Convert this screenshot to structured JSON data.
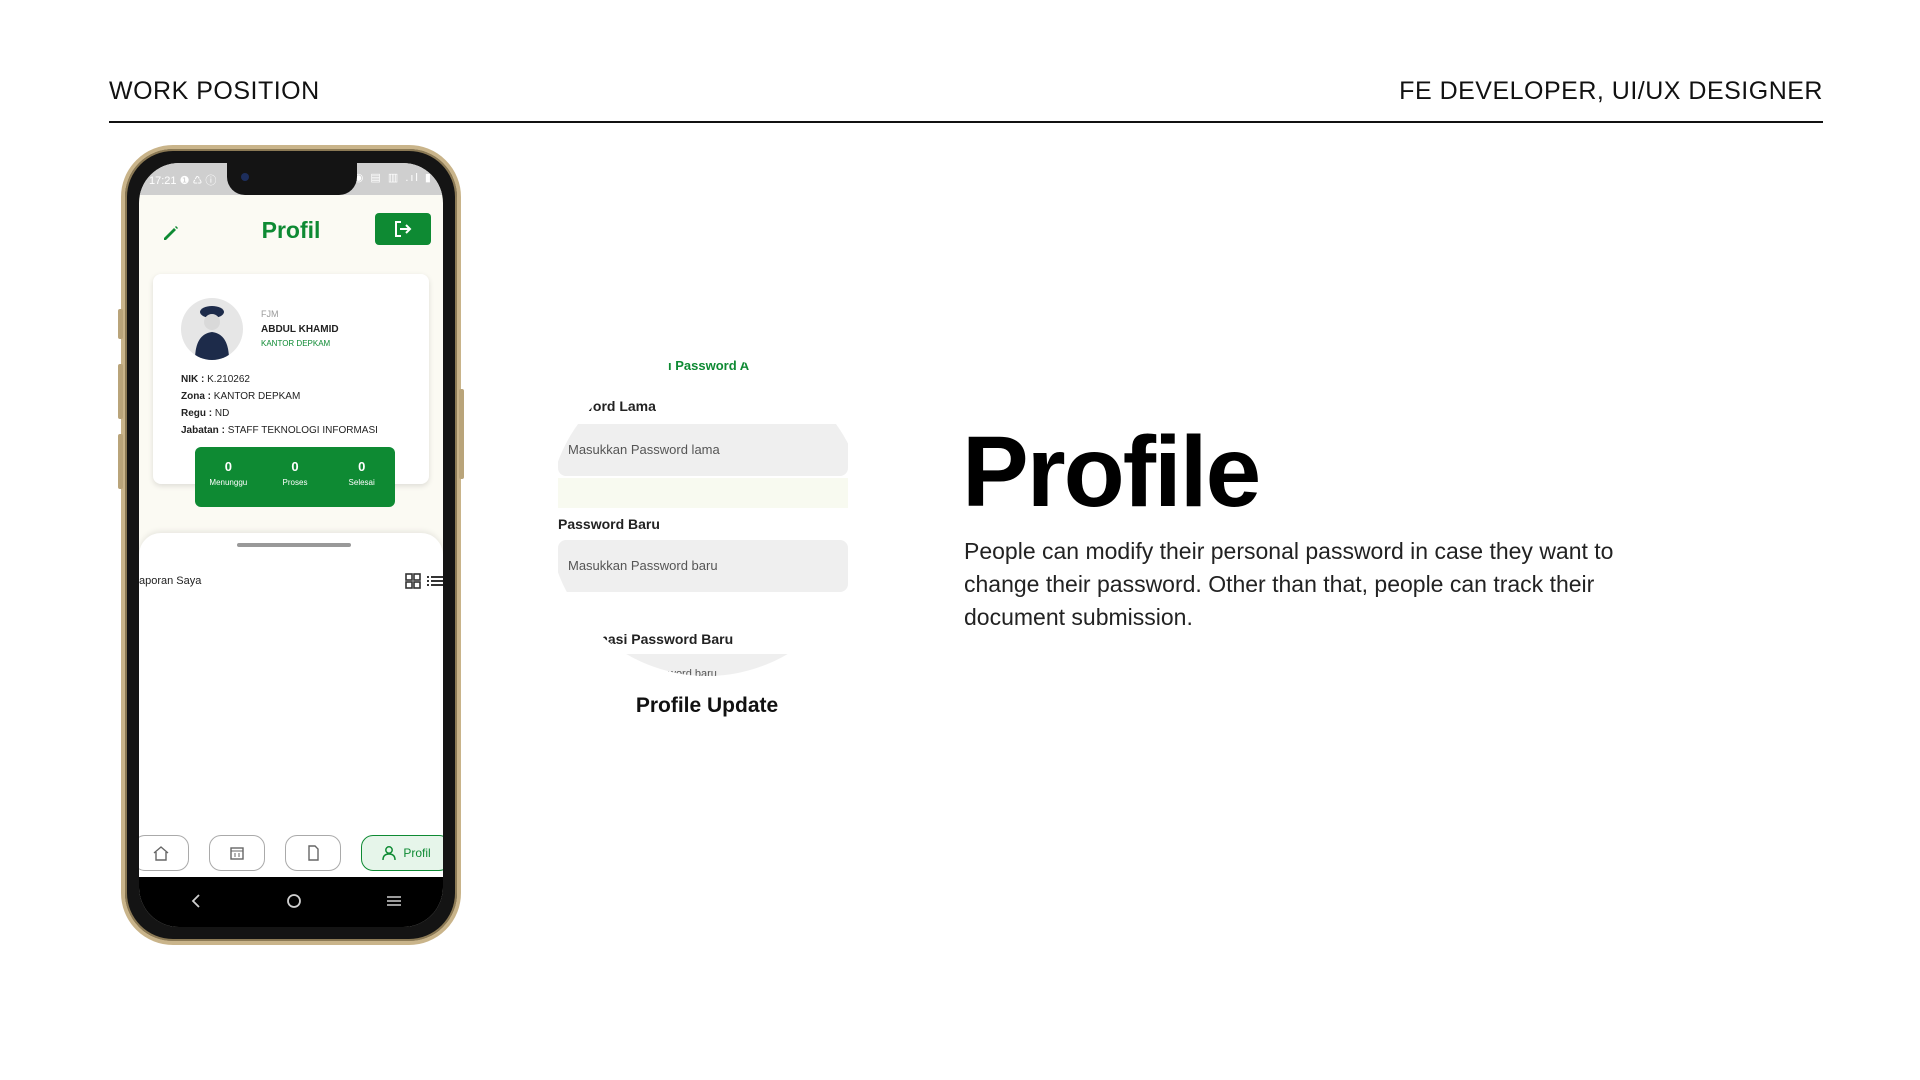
{
  "header": {
    "left_label": "WORK POSITION",
    "right_label": "FE DEVELOPER, UI/UX DESIGNER"
  },
  "phone": {
    "status_time": "17:21",
    "status_left_icons": "❶ ♺ ⓘ",
    "status_right_icons": "⚲ ◉ ▤ ▥ .ıl ▮",
    "app_title": "Profil",
    "profile": {
      "code": "FJM",
      "name": "ABDUL KHAMID",
      "office": "KANTOR DEPKAM",
      "fields": [
        {
          "label": "NIK :",
          "value": "K.210262"
        },
        {
          "label": "Zona :",
          "value": "KANTOR DEPKAM"
        },
        {
          "label": "Regu :",
          "value": "ND"
        },
        {
          "label": "Jabatan :",
          "value": "STAFF TEKNOLOGI INFORMASI"
        }
      ]
    },
    "stats": [
      {
        "value": "0",
        "label": "Menunggu"
      },
      {
        "value": "0",
        "label": "Proses"
      },
      {
        "value": "0",
        "label": "Selesai"
      }
    ],
    "sheet_title": "aporan Saya",
    "nav_active_label": "Profil",
    "icons": {
      "edit": "edit-icon",
      "logout": "logout-icon",
      "grid": "grid-icon",
      "list": "list-icon",
      "home": "home-icon",
      "calendar": "calendar-icon",
      "document": "document-icon",
      "user": "user-icon"
    }
  },
  "zoom": {
    "heading": "ı Password A",
    "old_label": "word Lama",
    "old_placeholder": "Masukkan Password lama",
    "new_label": "Password Baru",
    "new_placeholder": "Masukkan Password baru",
    "confirm_label": "rmasi Password Baru",
    "confirm_placeholder": "word baru",
    "caption": "Profile Update"
  },
  "feature": {
    "title": "Profile",
    "description": "People can modify their personal password in case they want to change their password. Other than that, people can track their document submission."
  },
  "colors": {
    "brand_green": "#0e8a33",
    "phone_frame": "#c9b48a"
  }
}
